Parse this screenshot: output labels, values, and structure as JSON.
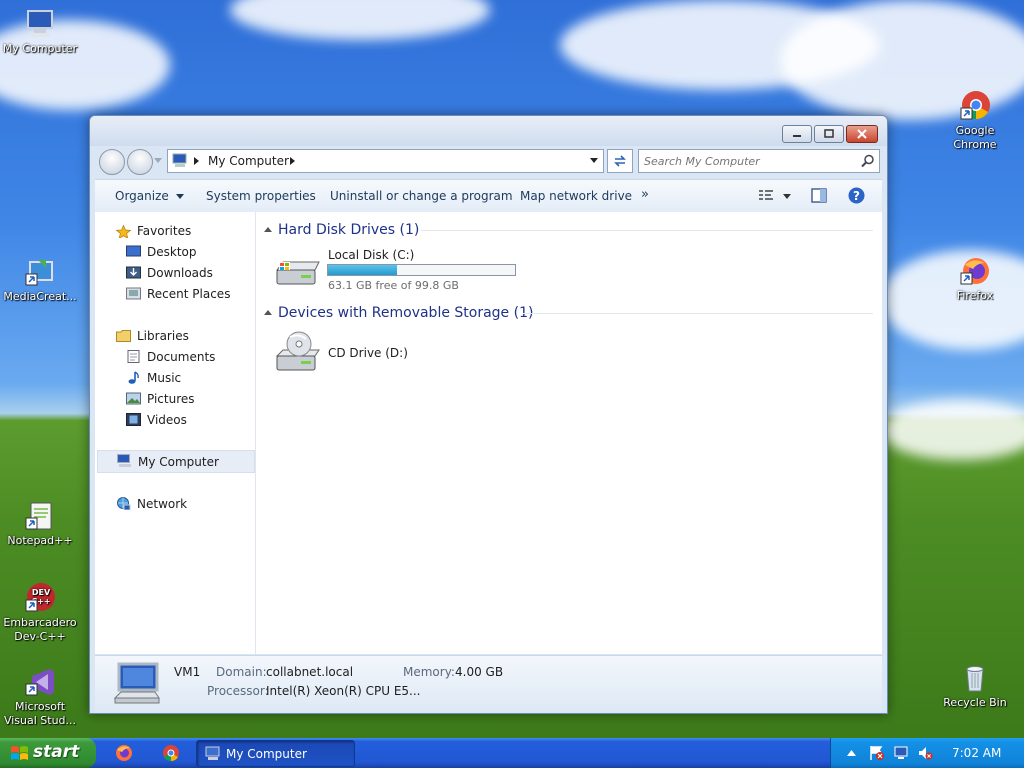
{
  "desktop": {
    "icons": [
      {
        "label": "My Computer"
      },
      {
        "label": "MediaCreat..."
      },
      {
        "label": "Notepad++"
      },
      {
        "label": "Embarcadero Dev-C++"
      },
      {
        "label": "Microsoft Visual Stud..."
      },
      {
        "label": "Google Chrome"
      },
      {
        "label": "Firefox"
      },
      {
        "label": "Recycle Bin"
      }
    ]
  },
  "window": {
    "address": {
      "segments": [
        "My Computer"
      ]
    },
    "search": {
      "placeholder": "Search My Computer"
    },
    "toolbar": {
      "organize": "Organize",
      "system_properties": "System properties",
      "uninstall": "Uninstall or change a program",
      "map_drive": "Map network drive",
      "more": "»"
    },
    "navpane": {
      "favorites": "Favorites",
      "desktop": "Desktop",
      "downloads": "Downloads",
      "recent": "Recent Places",
      "libraries": "Libraries",
      "documents": "Documents",
      "music": "Music",
      "pictures": "Pictures",
      "videos": "Videos",
      "my_computer": "My Computer",
      "network": "Network"
    },
    "groups": {
      "hdd": {
        "title": "Hard Disk Drives (1)",
        "drive": {
          "name": "Local Disk (C:)",
          "free_text": "63.1 GB free of 99.8 GB",
          "used_fraction": 0.368
        }
      },
      "removable": {
        "title": "Devices with Removable Storage (1)",
        "drive": {
          "name": "CD Drive (D:)"
        }
      }
    },
    "details": {
      "name": "VM1",
      "domain_label": "Domain:",
      "domain_value": "collabnet.local",
      "memory_label": "Memory:",
      "memory_value": "4.00 GB",
      "processor_label": "Processor:",
      "processor_value": "Intel(R) Xeon(R) CPU E5..."
    }
  },
  "taskbar": {
    "start": "start",
    "active_task": "My Computer",
    "clock": "7:02 AM"
  }
}
